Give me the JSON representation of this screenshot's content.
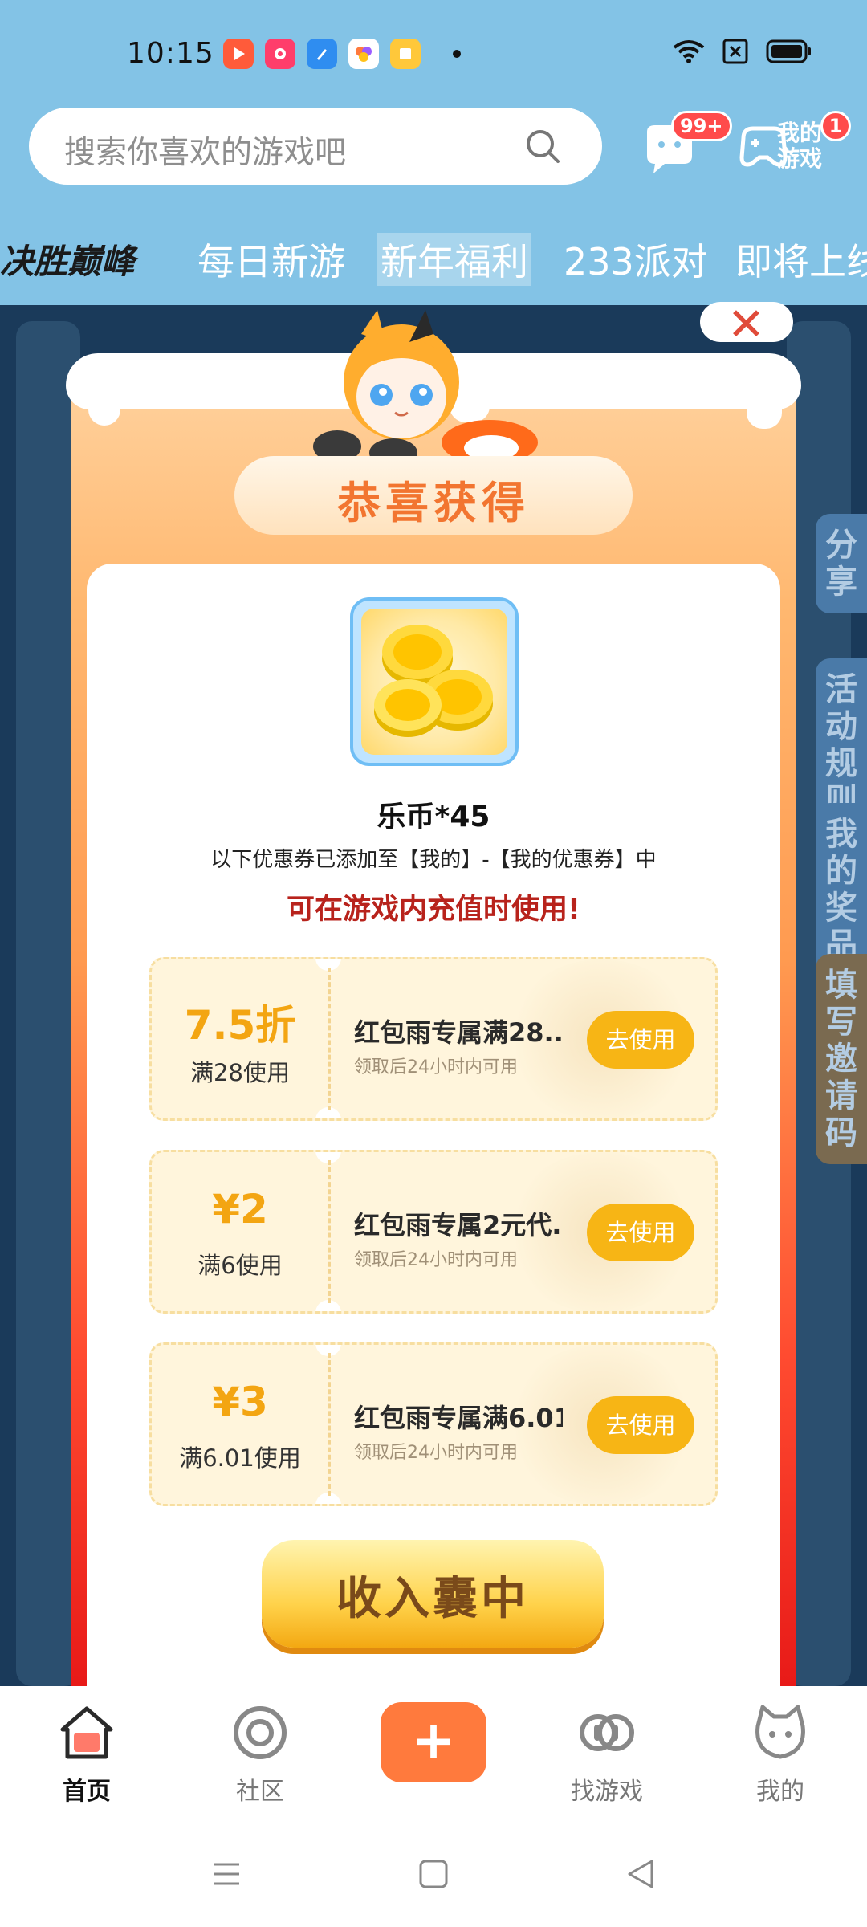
{
  "status_bar": {
    "time": "10:15",
    "app_icons": [
      "video-app-icon",
      "red-app-icon",
      "blue-app-icon",
      "colorful-app-icon",
      "book-app-icon"
    ],
    "right_icons": [
      "wifi-icon",
      "sim-x-icon",
      "battery-icon"
    ]
  },
  "header": {
    "search_placeholder": "搜索你喜欢的游戏吧",
    "msg_badge": "99+",
    "mygame_label": "我的游戏",
    "mygame_badge": "1"
  },
  "tabs": {
    "brand": "决胜巅峰",
    "items": [
      "每日新游",
      "新年福利",
      "233派对",
      "即将上线"
    ],
    "selected": "新年福利"
  },
  "background": {
    "side_tabs": [
      "分享",
      "活动规则",
      "我的奖品",
      "填写邀请码"
    ]
  },
  "modal": {
    "title": "恭喜获得",
    "reward_name": "乐币*45",
    "note": "以下优惠券已添加至【我的】-【我的优惠券】中",
    "highlight": "可在游戏内充值时使用!",
    "coupons": [
      {
        "value": "7.5折",
        "condition": "满28使用",
        "title": "红包雨专属满28...",
        "subtitle": "领取后24小时内可用",
        "button": "去使用"
      },
      {
        "value": "¥2",
        "condition": "满6使用",
        "title": "红包雨专属2元代...",
        "subtitle": "领取后24小时内可用",
        "button": "去使用"
      },
      {
        "value": "¥3",
        "condition": "满6.01使用",
        "title": "红包雨专属满6.01...",
        "subtitle": "领取后24小时内可用",
        "button": "去使用"
      }
    ],
    "collect_button": "收入囊中"
  },
  "bottom_nav": {
    "items": [
      {
        "label": "首页",
        "icon": "home-icon",
        "active": true
      },
      {
        "label": "社区",
        "icon": "community-icon",
        "active": false
      },
      {
        "label": "找游戏",
        "icon": "find-game-icon",
        "active": false
      },
      {
        "label": "我的",
        "icon": "profile-icon",
        "active": false
      }
    ],
    "fab_icon": "plus-icon"
  },
  "colors": {
    "header_bg": "#83c3e6",
    "accent_orange": "#ff7a3d",
    "coupon_yellow": "#f7b515",
    "highlight_red": "#b8231c"
  }
}
